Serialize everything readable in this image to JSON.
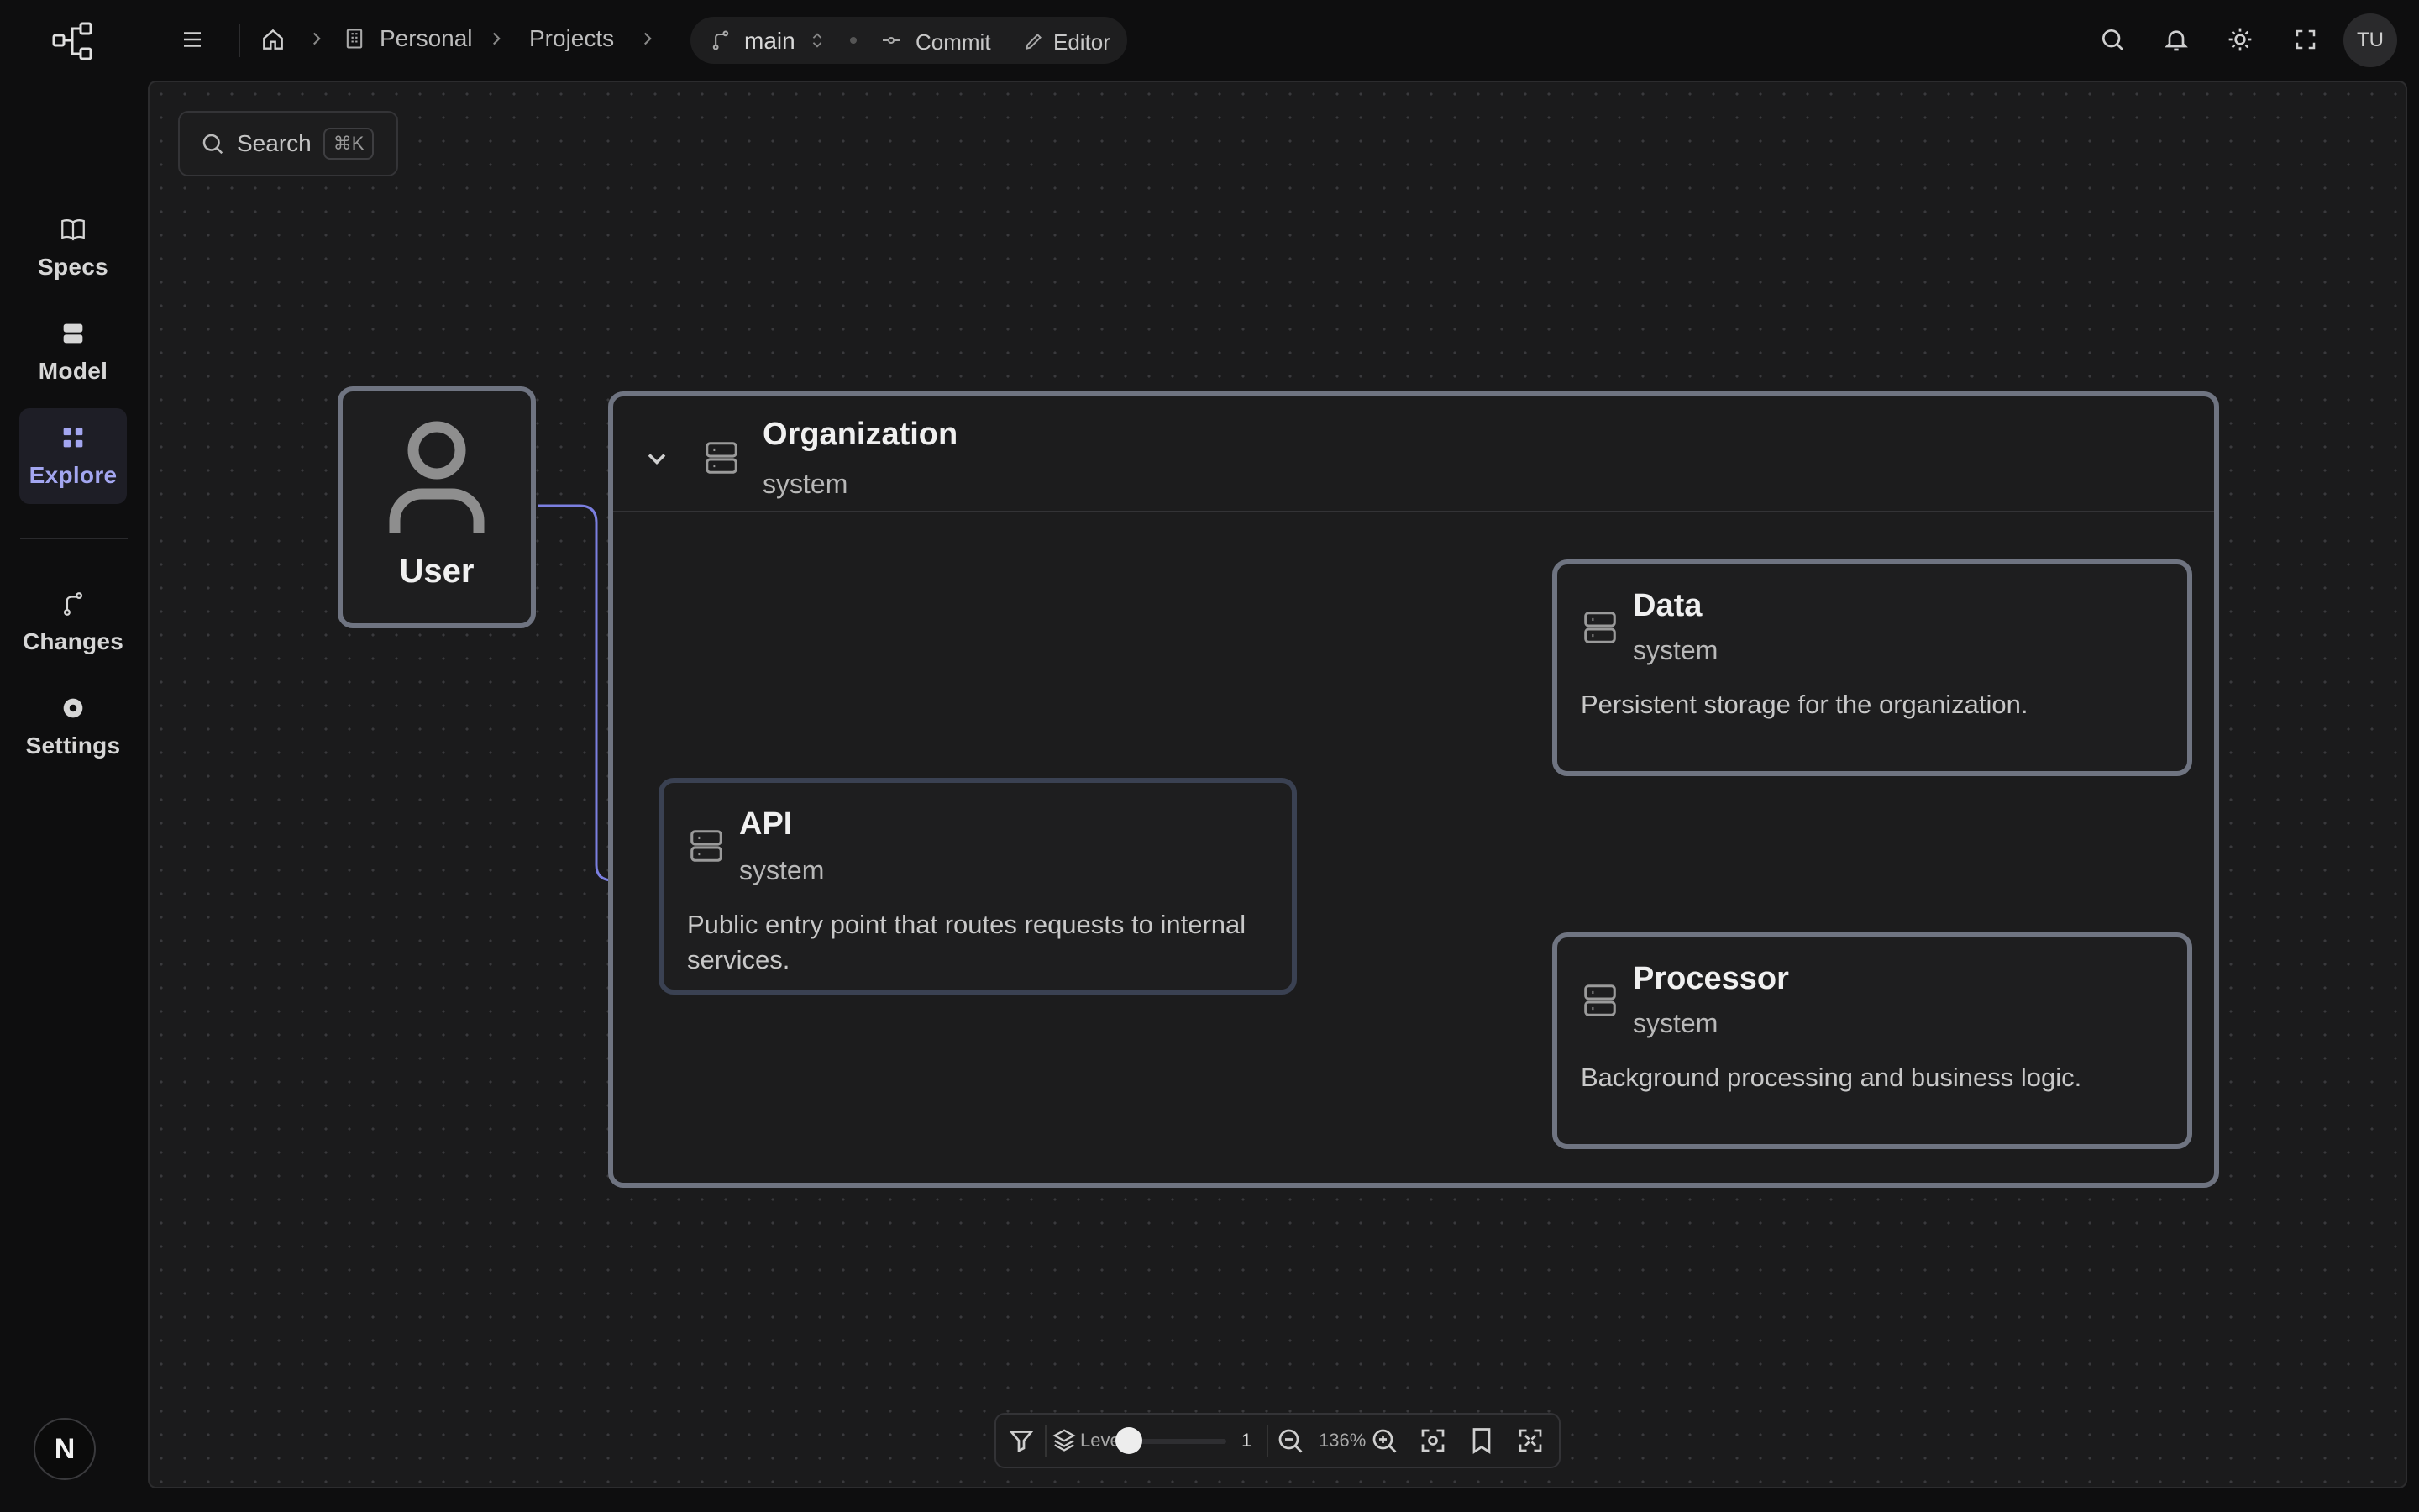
{
  "sidebar": {
    "items": [
      {
        "label": "Specs",
        "icon": "book-icon"
      },
      {
        "label": "Model",
        "icon": "database-icon"
      },
      {
        "label": "Explore",
        "icon": "grid-icon",
        "active": true
      },
      {
        "label": "Changes",
        "icon": "git-branch-icon"
      },
      {
        "label": "Settings",
        "icon": "gear-icon"
      }
    ],
    "bottom_avatar": "N"
  },
  "topbar": {
    "breadcrumbs": [
      "Personal",
      "Projects"
    ],
    "branch": "main",
    "commit_label": "Commit",
    "editor_label": "Editor",
    "user_initials": "TU"
  },
  "canvas": {
    "search_label": "Search",
    "search_shortcut": "⌘K",
    "nodes": {
      "user": {
        "title": "User"
      },
      "organization": {
        "title": "Organization",
        "kind": "system"
      },
      "api": {
        "title": "API",
        "kind": "system",
        "description": "Public entry point that routes requests to internal services."
      },
      "data": {
        "title": "Data",
        "kind": "system",
        "description": "Persistent storage for the organization."
      },
      "processor": {
        "title": "Processor",
        "kind": "system",
        "description": "Background processing and business logic."
      }
    },
    "edge_color": "#7b7fe0"
  },
  "toolbar": {
    "level_label": "Level",
    "level_value": "1",
    "zoom": "136%"
  },
  "colors": {
    "accent": "#a3a6f0",
    "node_border": "#6f7481",
    "canvas_bg": "#1b1b1c"
  }
}
